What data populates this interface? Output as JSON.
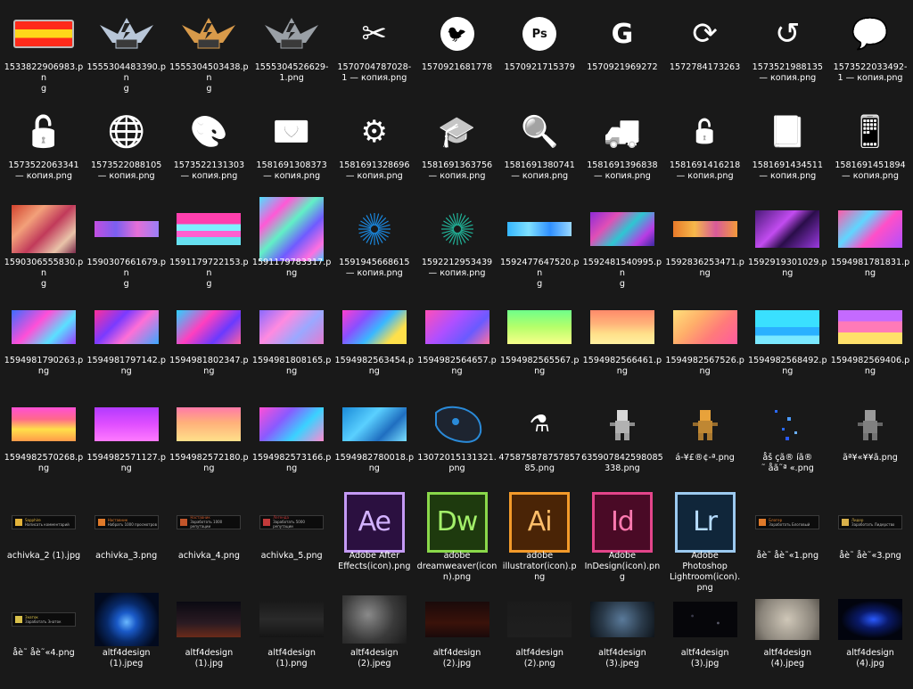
{
  "window": {
    "title": ""
  },
  "files": [
    {
      "name": "1533822906983.png",
      "label": "1533822906983.pn\ng",
      "icon": "flag-icon",
      "kind": "flag"
    },
    {
      "name": "1555304483390.png",
      "label": "1555304483390.pn\ng",
      "icon": "silver-rank-badge-icon",
      "kind": "badge-silver"
    },
    {
      "name": "1555304503438.png",
      "label": "1555304503438.pn\ng",
      "icon": "gold-rank-badge-icon",
      "kind": "badge-gold"
    },
    {
      "name": "1555304526629-1.png",
      "label": "1555304526629-\n1.png",
      "icon": "rank-badge-icon",
      "kind": "badge-grey"
    },
    {
      "name": "1570704787028-1 — копия.png",
      "label": "1570704787028-\n1 — копия.png",
      "icon": "scissors-icon",
      "kind": "glyph",
      "glyph": "✂"
    },
    {
      "name": "1570921681778",
      "label": "1570921681778",
      "icon": "twitter-icon",
      "kind": "circle",
      "glyph": "🐦"
    },
    {
      "name": "1570921715379",
      "label": "1570921715379",
      "icon": "photoshop-icon",
      "kind": "circle-text",
      "glyph": "Ps"
    },
    {
      "name": "1570921969272",
      "label": "1570921969272",
      "icon": "google-icon",
      "kind": "bold",
      "glyph": "G"
    },
    {
      "name": "1572784173263",
      "label": "1572784173263",
      "icon": "refresh-icon",
      "kind": "glyph",
      "glyph": "⟳"
    },
    {
      "name": "1573521988135 — копия.png",
      "label": "1573521988135\n— копия.png",
      "icon": "history-icon",
      "kind": "glyph",
      "glyph": "↺"
    },
    {
      "name": "1573522033492-1 — копия.png",
      "label": "1573522033492-\n1 — копия.png",
      "icon": "support-chat-icon",
      "kind": "glyph",
      "glyph": "💬"
    },
    {
      "name": "1573522063341 — копия.png",
      "label": "1573522063341\n— копия.png",
      "icon": "unlock-icon",
      "kind": "glyph",
      "glyph": "🔓"
    },
    {
      "name": "1573522088105 — копия.png",
      "label": "1573522088105\n— копия.png",
      "icon": "globe-icon",
      "kind": "glyph",
      "glyph": "🌐"
    },
    {
      "name": "1573522131303 — копия.png",
      "label": "1573522131303\n— копия.png",
      "icon": "palette-icon",
      "kind": "glyph",
      "glyph": "🎨"
    },
    {
      "name": "1581691308373 — копия.png",
      "label": "1581691308373\n— копия.png",
      "icon": "heart-card-icon",
      "kind": "glyph",
      "glyph": "💌"
    },
    {
      "name": "1581691328696 — копия.png",
      "label": "1581691328696\n— копия.png",
      "icon": "settings-gear-icon",
      "kind": "glyph",
      "glyph": "⚙"
    },
    {
      "name": "1581691363756 — копия.png",
      "label": "1581691363756\n— копия.png",
      "icon": "graduation-cap-icon",
      "kind": "glyph",
      "glyph": "🎓"
    },
    {
      "name": "1581691380741 — копия.png",
      "label": "1581691380741\n— копия.png",
      "icon": "search-icon",
      "kind": "glyph",
      "glyph": "🔍"
    },
    {
      "name": "1581691396838 — копия.png",
      "label": "1581691396838\n— копия.png",
      "icon": "delivery-truck-icon",
      "kind": "glyph",
      "glyph": "🚚"
    },
    {
      "name": "1581691416218 — копия.png",
      "label": "1581691416218\n— копия.png",
      "icon": "unlock-icon",
      "kind": "glyph-small",
      "glyph": "🔓"
    },
    {
      "name": "1581691434511 — копия.png",
      "label": "1581691434511\n— копия.png",
      "icon": "book-icon",
      "kind": "glyph",
      "glyph": "📕"
    },
    {
      "name": "1581691451894 — копия.png",
      "label": "1581691451894\n— копия.png",
      "icon": "tablet-touch-icon",
      "kind": "glyph",
      "glyph": "📱"
    },
    {
      "name": "1590306555830.png",
      "label": "1590306555830.pn\ng",
      "icon": "abstract-image-icon",
      "kind": "img",
      "w": 72,
      "h": 54,
      "bg": "linear-gradient(135deg,#d2432e,#f2a07a 30%,#c13a5a 55%,#e9c4a9 80%,#7a2a4a)"
    },
    {
      "name": "1590307661679.png",
      "label": "1590307661679.pn\ng",
      "icon": "abstract-image-icon",
      "kind": "img",
      "w": 72,
      "h": 18,
      "bg": "linear-gradient(90deg,#c34fe0,#7a5ff0,#e56fd6,#9a7ef7)"
    },
    {
      "name": "1591179722153.png",
      "label": "1591179722153.pn\ng",
      "icon": "abstract-image-icon",
      "kind": "img",
      "w": 72,
      "h": 36,
      "bg": "linear-gradient(180deg,#ff3fae 0 35%,#7ff0ff 35% 55%,#ff5fd0 55% 75%,#66e0f0 75%)"
    },
    {
      "name": "1591179783317.png",
      "label": "1591179783317.p\nng",
      "icon": "abstract-image-icon",
      "kind": "img",
      "w": 72,
      "h": 72,
      "bg": "linear-gradient(135deg,#4de0ff,#ff59d6 25%,#62f0c6 45%,#6f5bff 65%,#ff6fe0 85%,#44c8ff)"
    },
    {
      "name": "1591945668615 — копия.png",
      "label": "1591945668615\n— копия.png",
      "icon": "starburst-icon",
      "kind": "burst",
      "color": "#1a88e0"
    },
    {
      "name": "1592212953439 — копия.png",
      "label": "1592212953439\n— копия.png",
      "icon": "starburst-icon",
      "kind": "burst",
      "color": "#21b59a"
    },
    {
      "name": "1592477647520.png",
      "label": "1592477647520.pn\ng",
      "icon": "abstract-image-icon",
      "kind": "img",
      "w": 72,
      "h": 16,
      "bg": "linear-gradient(90deg,#34b6ff,#7fe0ff,#2f8fff,#9ad8ff)"
    },
    {
      "name": "1592481540995.png",
      "label": "1592481540995.pn\ng",
      "icon": "abstract-image-icon",
      "kind": "img",
      "w": 72,
      "h": 38,
      "bg": "linear-gradient(135deg,#8e2bd6,#e04fb6 30%,#2ec6d2 55%,#b83be4 80%,#3a2aa0)"
    },
    {
      "name": "1592836253471.png",
      "label": "1592836253471.p\nng",
      "icon": "abstract-image-icon",
      "kind": "img",
      "w": 72,
      "h": 18,
      "bg": "linear-gradient(90deg,#e87a2a,#f6b84a,#d85a9a,#f39a3a)"
    },
    {
      "name": "1592919301029.png",
      "label": "1592919301029.p\nng",
      "icon": "abstract-image-icon",
      "kind": "img",
      "w": 72,
      "h": 42,
      "bg": "linear-gradient(135deg,#4a1a7a,#c24cf0 40%,#2a0d4a 60%,#9a3ae0)"
    },
    {
      "name": "1594981781831.png",
      "label": "1594981781831.p\nng",
      "icon": "abstract-image-icon",
      "kind": "img",
      "w": 72,
      "h": 42,
      "bg": "linear-gradient(135deg,#ff5aa8,#5fd6ff 35%,#ff4fc8 60%,#b04fff)"
    },
    {
      "name": "1594981790263.png",
      "label": "1594981790263.p\nng",
      "icon": "abstract-image-icon",
      "kind": "img",
      "w": 72,
      "h": 38,
      "bg": "linear-gradient(135deg,#3b6cff,#ff4fd8 40%,#5ae0ff 70%,#9a3aff)"
    },
    {
      "name": "1594981797142.png",
      "label": "1594981797142.p\nng",
      "icon": "abstract-image-icon",
      "kind": "img",
      "w": 72,
      "h": 38,
      "bg": "linear-gradient(135deg,#ff2f9a,#7a3aff 35%,#ff6fd6 60%,#3aa8ff)"
    },
    {
      "name": "1594981802347.png",
      "label": "1594981802347.p\nng",
      "icon": "abstract-image-icon",
      "kind": "img",
      "w": 72,
      "h": 38,
      "bg": "linear-gradient(135deg,#2ad2ff,#ff3fbf 40%,#6a3aff 70%,#ff5fa0)"
    },
    {
      "name": "1594981808165.png",
      "label": "1594981808165.p\nng",
      "icon": "abstract-image-icon",
      "kind": "img",
      "w": 72,
      "h": 38,
      "bg": "linear-gradient(135deg,#8a6aff,#ff8ae0 35%,#9aa8ff 65%,#e67ad0)"
    },
    {
      "name": "1594982563454.png",
      "label": "1594982563454.png",
      "icon": "gradient-image-icon",
      "kind": "img",
      "w": 72,
      "h": 38,
      "bg": "linear-gradient(135deg,#ff3fd0,#8a4fff 30%,#3ab8ff 55%,#ffe04a 80%)"
    },
    {
      "name": "1594982564657.png",
      "label": "1594982564657.p\nng",
      "icon": "gradient-image-icon",
      "kind": "img",
      "w": 72,
      "h": 38,
      "bg": "linear-gradient(135deg,#ff4fb8,#b04fff 40%,#6a5aff 70%,#ff6fa0)"
    },
    {
      "name": "1594982565567.png",
      "label": "1594982565567.p\nng",
      "icon": "gradient-image-icon",
      "kind": "img",
      "w": 72,
      "h": 38,
      "bg": "linear-gradient(180deg,#6fff8a,#b6ff6a 50%,#f8ff8a)"
    },
    {
      "name": "1594982566461.png",
      "label": "1594982566461.p\nng",
      "icon": "gradient-image-icon",
      "kind": "img",
      "w": 72,
      "h": 38,
      "bg": "linear-gradient(180deg,#ff8a6a,#ffb37a 40%,#ffe08a 70%,#fff0a0)"
    },
    {
      "name": "1594982567526.png",
      "label": "1594982567526.p\nng",
      "icon": "gradient-image-icon",
      "kind": "img",
      "w": 72,
      "h": 38,
      "bg": "linear-gradient(135deg,#ffe07a,#ffae6a 35%,#ff7a7a 65%,#ff5aa0)"
    },
    {
      "name": "1594982568492.png",
      "label": "1594982568492.p\nng",
      "icon": "gradient-image-icon",
      "kind": "img",
      "w": 72,
      "h": 38,
      "bg": "linear-gradient(180deg,#3ae0ff 0 50%,#2ab0ff 50% 75%,#7ae8ff 75%)"
    },
    {
      "name": "1594982569406.png",
      "label": "1594982569406.p\nng",
      "icon": "gradient-image-icon",
      "kind": "img",
      "w": 72,
      "h": 38,
      "bg": "linear-gradient(180deg,#c46aff 0 33%,#ff7ab8 33% 66%,#ffe06a 66%)"
    },
    {
      "name": "1594982570268.png",
      "label": "1594982570268.p\nng",
      "icon": "gradient-image-icon",
      "kind": "img",
      "w": 72,
      "h": 38,
      "bg": "linear-gradient(180deg,#ff4fd6,#ff6a8a 35%,#ffe04a 65%,#ff9a4a)"
    },
    {
      "name": "1594982571127.png",
      "label": "1594982571127.p\nng",
      "icon": "gradient-image-icon",
      "kind": "img",
      "w": 72,
      "h": 38,
      "bg": "linear-gradient(180deg,#b23aff,#e04fff 50%,#ff7aff)"
    },
    {
      "name": "1594982572180.png",
      "label": "1594982572180.p\nng",
      "icon": "gradient-image-icon",
      "kind": "img",
      "w": 72,
      "h": 38,
      "bg": "linear-gradient(180deg,#ff7aa8,#ffb07a 45%,#ffe08a)"
    },
    {
      "name": "1594982573166.png",
      "label": "1594982573166.p\nng",
      "icon": "gradient-image-icon",
      "kind": "img",
      "w": 72,
      "h": 38,
      "bg": "linear-gradient(135deg,#ff4fd6,#8a5aff 35%,#3ad2ff 65%,#ff8ad0)"
    },
    {
      "name": "1594982780018.png",
      "label": "1594982780018.p\nng",
      "icon": "water-image-icon",
      "kind": "img",
      "w": 72,
      "h": 38,
      "bg": "linear-gradient(135deg,#1a8ad8,#5ad0ff 40%,#1f6ec0 70%,#7ae0ff)"
    },
    {
      "name": "13072015131321.png",
      "label": "13072015131321.\npng",
      "icon": "gaming-mouse-icon",
      "kind": "mouse"
    },
    {
      "name": "475875878757857 85.png",
      "label": "475875878757857\n85.png",
      "icon": "potion-icon",
      "kind": "glyph-small",
      "glyph": "⚗"
    },
    {
      "name": "635907842598085338.png",
      "label": "635907842598085\n338.png",
      "icon": "pixel-character-icon",
      "kind": "pixel",
      "color": "#d8d8d8"
    },
    {
      "name": "á-¥£®¢-ª.png",
      "label": "á-¥£®¢-ª.png",
      "icon": "pixel-character-icon",
      "kind": "pixel",
      "color": "#e8a23a"
    },
    {
      "name": "åš çã® íã® ˜ åã˜ª «.png",
      "label": "åš çã® íã®\n˜ åã˜ª «.png",
      "icon": "pixel-particles-icon",
      "kind": "particles"
    },
    {
      "name": "ãª¥«¥¥ã.png",
      "label": "ãª¥«¥¥ã.png",
      "icon": "pixel-character-icon",
      "kind": "pixel",
      "color": "#9a9a9a"
    },
    {
      "name": "achivka_2 (1).jpg",
      "label": "achivka_2 (1).jpg",
      "icon": "achievement-banner-icon",
      "kind": "achv",
      "color": "#e3b33a",
      "line1": "Sapphire",
      "line2": "Написать комментарий"
    },
    {
      "name": "achivka_3.png",
      "label": "achivka_3.png",
      "icon": "achievement-banner-icon",
      "kind": "achv",
      "color": "#e07a2a",
      "line1": "Наставник",
      "line2": "Набрать 1000 просмотров"
    },
    {
      "name": "achivka_4.png",
      "label": "achivka_4.png",
      "icon": "achievement-banner-icon",
      "kind": "achv",
      "color": "#c2552a",
      "line1": "Наставник",
      "line2": "Заработать 1000 репутации"
    },
    {
      "name": "achivka_5.png",
      "label": "achivka_5.png",
      "icon": "achievement-banner-icon",
      "kind": "achv",
      "color": "#c23a3a",
      "line1": "Легенда",
      "line2": "Заработать 5000 репутации"
    },
    {
      "name": "Adobe After Effects(icon).png",
      "label": "Adobe After\nEffects(icon).png",
      "icon": "after-effects-icon",
      "kind": "adobe",
      "glyph": "Ae",
      "fg": "#d3b3ff",
      "bg": "#2b1040",
      "br": "#c49af5"
    },
    {
      "name": "adobe dreamweaver(icon).png",
      "label": "adobe\ndreamweaver(icon\nn).png",
      "icon": "dreamweaver-icon",
      "kind": "adobe",
      "glyph": "Dw",
      "fg": "#a3f06a",
      "bg": "#1e3a0e",
      "br": "#8ad84a"
    },
    {
      "name": "adobe illustrator(icon).png",
      "label": "adobe\nillustrator(icon).p\nng",
      "icon": "illustrator-icon",
      "kind": "adobe",
      "glyph": "Ai",
      "fg": "#ffbf6a",
      "bg": "#4a2406",
      "br": "#f39a2a"
    },
    {
      "name": "Adobe InDesign(icon).png",
      "label": "Adobe\nInDesign(icon).pn\ng",
      "icon": "indesign-icon",
      "kind": "adobe",
      "glyph": "Id",
      "fg": "#ff7ab0",
      "bg": "#4a0a26",
      "br": "#e3458a"
    },
    {
      "name": "Adobe Photoshop Lightroom(icon).png",
      "label": "Adobe\nPhotoshop\nLightroom(icon).\npng",
      "icon": "lightroom-icon",
      "kind": "adobe",
      "glyph": "Lr",
      "fg": "#b6dcff",
      "bg": "#10263a",
      "br": "#9ccaf0"
    },
    {
      "name": "åè˜ åè˜«1.png",
      "label": "åè˜ åè˜«1.png",
      "icon": "achievement-banner-icon",
      "kind": "achv",
      "color": "#e07a2a",
      "line1": "Блогер",
      "line2": "Заработать Блоговый"
    },
    {
      "name": "åè˜ åè˜«3.png",
      "label": "åè˜ åè˜«3.png",
      "icon": "achievement-banner-icon",
      "kind": "achv",
      "color": "#d8b04a",
      "line1": "Лидер",
      "line2": "Заработать Лидерство"
    },
    {
      "name": "åè˜ åè˜«4.png",
      "label": "åè˜ åè˜«4.png",
      "icon": "achievement-banner-icon",
      "kind": "achv",
      "color": "#d8c04a",
      "line1": "Знаток",
      "line2": "Заработать Знаток"
    },
    {
      "name": "altf4design (1).jpeg",
      "label": "altf4design\n(1).jpeg",
      "icon": "space-image-icon",
      "kind": "img",
      "w": 72,
      "h": 60,
      "bg": "radial-gradient(circle at 50% 55%,#6ab8ff 0,#1a5ac8 22%,#082a6a 45%,#020a1e 75%)"
    },
    {
      "name": "altf4design (1).jpg",
      "label": "altf4design\n(1).jpg",
      "icon": "dark-texture-image-icon",
      "kind": "img",
      "w": 72,
      "h": 40,
      "bg": "linear-gradient(180deg,#0a0a12,#2a1a22 60%,#6a2a1a)"
    },
    {
      "name": "altf4design (1).png",
      "label": "altf4design\n(1).png",
      "icon": "dark-texture-image-icon",
      "kind": "img",
      "w": 72,
      "h": 40,
      "bg": "linear-gradient(180deg,#1a1a1a,#2a2a2a 50%,#151515)"
    },
    {
      "name": "altf4design (2).jpeg",
      "label": "altf4design\n(2).jpeg",
      "icon": "grunge-texture-image-icon",
      "kind": "img",
      "w": 72,
      "h": 54,
      "bg": "radial-gradient(circle at 40% 40%,#8a8a8a,#3a3a3a 55%,#1a1a1a)"
    },
    {
      "name": "altf4design (2).jpg",
      "label": "altf4design\n(2).jpg",
      "icon": "dark-texture-image-icon",
      "kind": "img",
      "w": 72,
      "h": 40,
      "bg": "linear-gradient(180deg,#1a0a0a,#3a120a 60%,#1a0a0a)"
    },
    {
      "name": "altf4design (2).png",
      "label": "altf4design\n(2).png",
      "icon": "dark-texture-image-icon",
      "kind": "img",
      "w": 72,
      "h": 40,
      "bg": "linear-gradient(180deg,#1b1b1b,#1f1f1f)"
    },
    {
      "name": "altf4design (3).jpeg",
      "label": "altf4design\n(3).jpeg",
      "icon": "smoke-texture-image-icon",
      "kind": "img",
      "w": 72,
      "h": 40,
      "bg": "radial-gradient(circle at 50% 50%,#5a7a9a,#2a3a4a 55%,#0e141a)"
    },
    {
      "name": "altf4design (3).jpg",
      "label": "altf4design\n(3).jpg",
      "icon": "starfield-image-icon",
      "kind": "img",
      "w": 72,
      "h": 40,
      "bg": "radial-gradient(circle at 30% 40%,#3a3a4a 0 2%,transparent 3%),radial-gradient(circle at 70% 60%,#5a5a6a 0 2%,transparent 3%),#06060a"
    },
    {
      "name": "altf4design (4).jpeg",
      "label": "altf4design\n(4).jpeg",
      "icon": "paper-texture-image-icon",
      "kind": "img",
      "w": 72,
      "h": 46,
      "bg": "radial-gradient(circle at 50% 50%,#cfc7b8,#8a847a 70%,#5a554e)"
    },
    {
      "name": "altf4design (4).jpg",
      "label": "altf4design\n(4).jpg",
      "icon": "nebula-image-icon",
      "kind": "img",
      "w": 72,
      "h": 46,
      "bg": "radial-gradient(ellipse at 55% 50%,#2a5aff 0,#0a1a6a 30%,#02040e 65%)"
    }
  ]
}
